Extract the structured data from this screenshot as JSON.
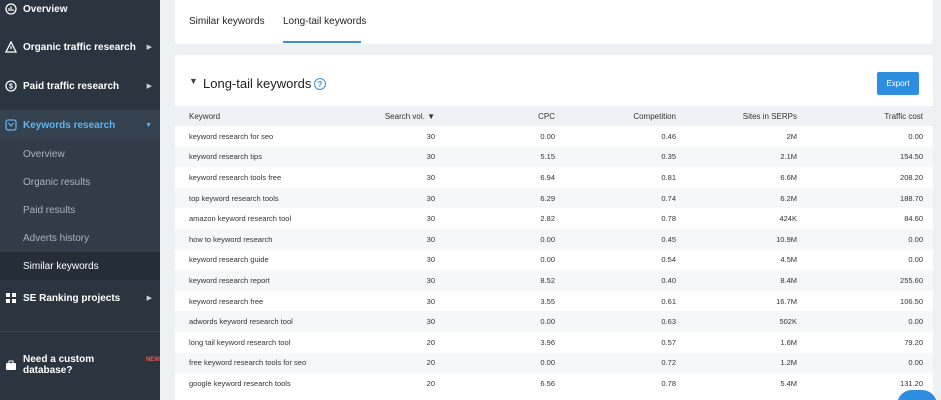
{
  "sidebar": {
    "items": [
      {
        "label": "Overview",
        "icon": "gauge-icon"
      },
      {
        "label": "Organic traffic research",
        "icon": "warning-triangle-icon"
      },
      {
        "label": "Paid traffic research",
        "icon": "dollar-circle-icon"
      },
      {
        "label": "Keywords research",
        "icon": "key-square-icon"
      },
      {
        "label": "SE Ranking projects",
        "icon": "grid-icon"
      }
    ],
    "sub_items": [
      "Overview",
      "Organic results",
      "Paid results",
      "Adverts history",
      "Similar keywords"
    ],
    "custom_db": {
      "label": "Need a custom database?",
      "badge": "NEW"
    }
  },
  "tabs": [
    {
      "label": "Similar keywords"
    },
    {
      "label": "Long-tail keywords"
    }
  ],
  "section": {
    "title": "Long-tail keywords",
    "help": "?",
    "export_label": "Export"
  },
  "table": {
    "columns": [
      "Keyword",
      "Search vol. ▼",
      "CPC",
      "Competition",
      "Sites in SERPs",
      "Traffic cost"
    ],
    "rows": [
      [
        "keyword research for seo",
        "30",
        "0.00",
        "0.46",
        "2M",
        "0.00"
      ],
      [
        "keyword research tips",
        "30",
        "5.15",
        "0.35",
        "2.1M",
        "154.50"
      ],
      [
        "keyword research tools free",
        "30",
        "6.94",
        "0.81",
        "6.6M",
        "208.20"
      ],
      [
        "top keyword research tools",
        "30",
        "6.29",
        "0.74",
        "6.2M",
        "188.70"
      ],
      [
        "amazon keyword research tool",
        "30",
        "2.82",
        "0.78",
        "424K",
        "84.60"
      ],
      [
        "how to keyword research",
        "30",
        "0.00",
        "0.45",
        "10.9M",
        "0.00"
      ],
      [
        "keyword research guide",
        "30",
        "0.00",
        "0.54",
        "4.5M",
        "0.00"
      ],
      [
        "keyword research report",
        "30",
        "8.52",
        "0.40",
        "8.4M",
        "255.60"
      ],
      [
        "keyword research free",
        "30",
        "3.55",
        "0.61",
        "16.7M",
        "106.50"
      ],
      [
        "adwords keyword research tool",
        "30",
        "0.00",
        "0.63",
        "502K",
        "0.00"
      ],
      [
        "long tail keyword research tool",
        "20",
        "3.96",
        "0.57",
        "1.6M",
        "79.20"
      ],
      [
        "free keyword research tools for seo",
        "20",
        "0.00",
        "0.72",
        "1.2M",
        "0.00"
      ],
      [
        "google keyword research tools",
        "20",
        "6.56",
        "0.78",
        "5.4M",
        "131.20"
      ]
    ]
  },
  "colors": {
    "sidebar": "#2b3540",
    "accent": "#2f8ddf",
    "active_text": "#5fb3f0"
  }
}
